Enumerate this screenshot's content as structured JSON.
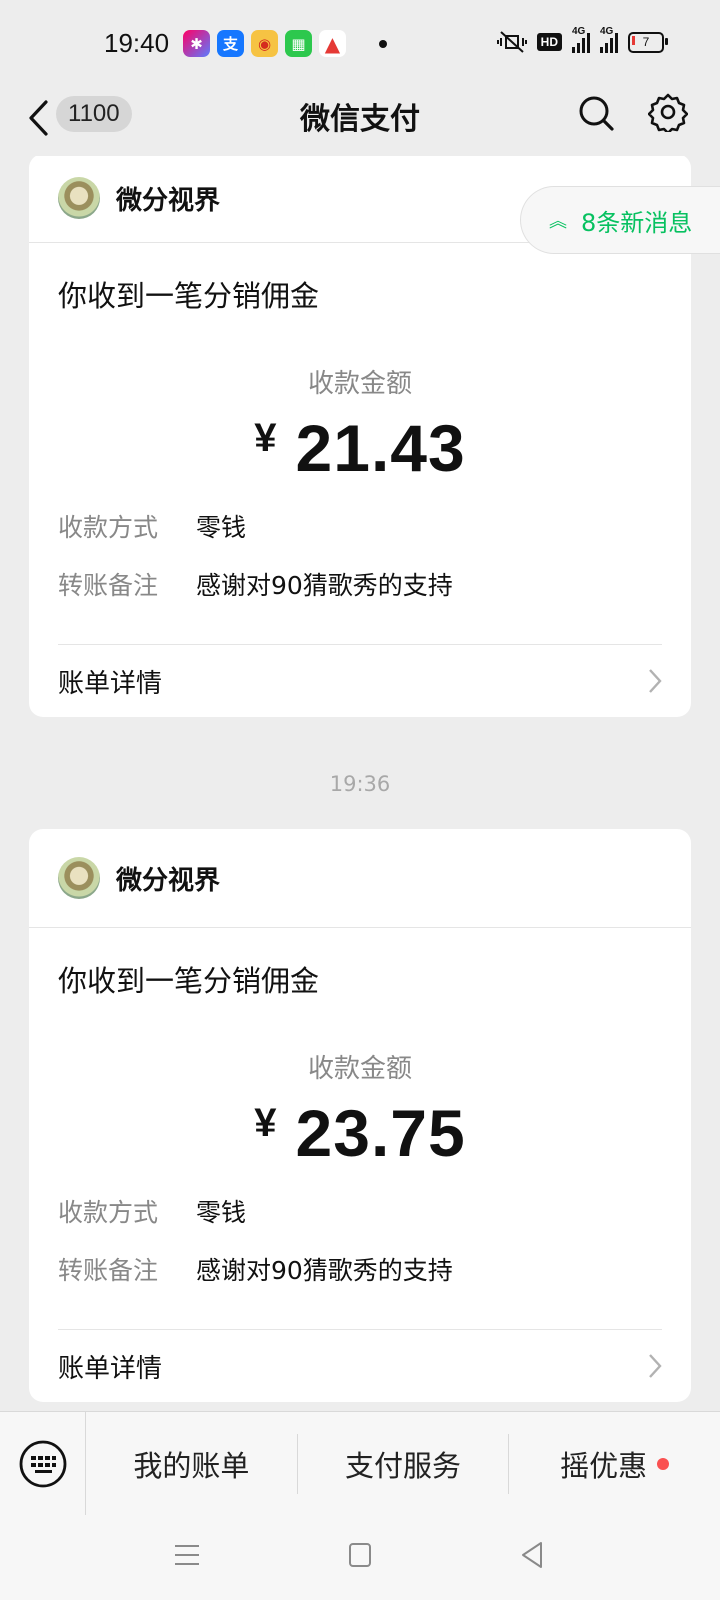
{
  "status_bar": {
    "time": "19:40",
    "icons": [
      "app-store-icon",
      "alipay-icon",
      "weibo-icon",
      "green-app-icon",
      "red-app-icon",
      "dot-icon",
      "mute-vibrate-icon",
      "hd-icon",
      "signal-4g-icon",
      "signal-4g-2-icon",
      "battery-icon"
    ],
    "hd_label": "HD",
    "net1": "4G",
    "net2": "4G",
    "battery": "7"
  },
  "nav": {
    "unread_count": "1100",
    "title": "微信支付"
  },
  "new_messages": "8条新消息",
  "cards": [
    {
      "merchant": "微分视界",
      "title": "你收到一笔分销佣金",
      "amount_label": "收款金额",
      "currency": "¥",
      "amount": "21.43",
      "method_key": "收款方式",
      "method_value": "零钱",
      "note_key": "转账备注",
      "note_value": "感谢对90猜歌秀的支持",
      "detail_label": "账单详情"
    },
    {
      "merchant": "微分视界",
      "title": "你收到一笔分销佣金",
      "amount_label": "收款金额",
      "currency": "¥",
      "amount": "23.75",
      "method_key": "收款方式",
      "method_value": "零钱",
      "note_key": "转账备注",
      "note_value": "感谢对90猜歌秀的支持",
      "detail_label": "账单详情"
    }
  ],
  "timestamp": "19:36",
  "bottom_menu": [
    "我的账单",
    "支付服务",
    "摇优惠"
  ],
  "colors": {
    "accent_green": "#07C160",
    "red_dot": "#FA5151",
    "background": "#EDEDED"
  }
}
